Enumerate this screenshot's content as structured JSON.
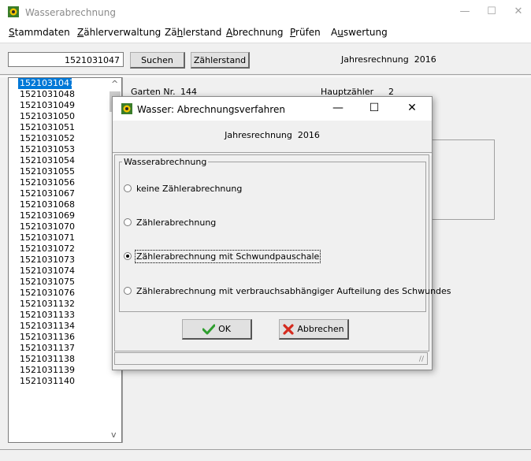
{
  "window": {
    "title": "Wasserabrechnung",
    "controls": {
      "minimize": "—",
      "maximize": "☐",
      "close": "✕"
    }
  },
  "menu": [
    {
      "underline": "S",
      "rest": "tammdaten"
    },
    {
      "underline": "Z",
      "rest": "ählerverwaltung"
    },
    {
      "pre": "Zä",
      "underline": "h",
      "rest": "lerstand"
    },
    {
      "underline": "A",
      "rest": "brechnung"
    },
    {
      "underline": "P",
      "rest": "rüfen"
    },
    {
      "pre": "A",
      "underline": "u",
      "rest": "swertung"
    }
  ],
  "toolbar": {
    "search_value": "1521031047",
    "search_button": "Suchen",
    "zaehlerstand_button": "Zählerstand",
    "jahres_label": "Jahresrechnung",
    "jahres_year": "2016"
  },
  "list": {
    "items": [
      "1521031047",
      "1521031048",
      "1521031049",
      "1521031050",
      "1521031051",
      "1521031052",
      "1521031053",
      "1521031054",
      "1521031055",
      "1521031056",
      "1521031067",
      "1521031068",
      "1521031069",
      "1521031070",
      "1521031071",
      "1521031072",
      "1521031073",
      "1521031074",
      "1521031075",
      "1521031076",
      "1521031132",
      "1521031133",
      "1521031134",
      "1521031136",
      "1521031137",
      "1521031138",
      "1521031139",
      "1521031140"
    ],
    "selected_index": 0
  },
  "details": {
    "garten_label": "Garten Nr.",
    "garten_value": "144",
    "hauptzaehler_label": "Hauptzähler",
    "hauptzaehler_value": "2"
  },
  "dialog": {
    "title": "Wasser: Abrechnungsverfahren",
    "jahres_label": "Jahresrechnung",
    "jahres_year": "2016",
    "group_label": "Wasserabrechnung",
    "options": [
      "keine Zählerabrechnung",
      "Zählerabrechnung",
      "Zählerabrechnung mit Schwundpauschale",
      "Zählerabrechnung mit verbrauchsabhängiger Aufteilung des Schwundes"
    ],
    "selected_option": 2,
    "ok_label": "OK",
    "cancel_label": "Abbrechen",
    "colors": {
      "ok_check": "#2e9e2e",
      "cancel_x": "#d42a1e"
    }
  },
  "colors": {
    "selection": "#0078d7"
  }
}
